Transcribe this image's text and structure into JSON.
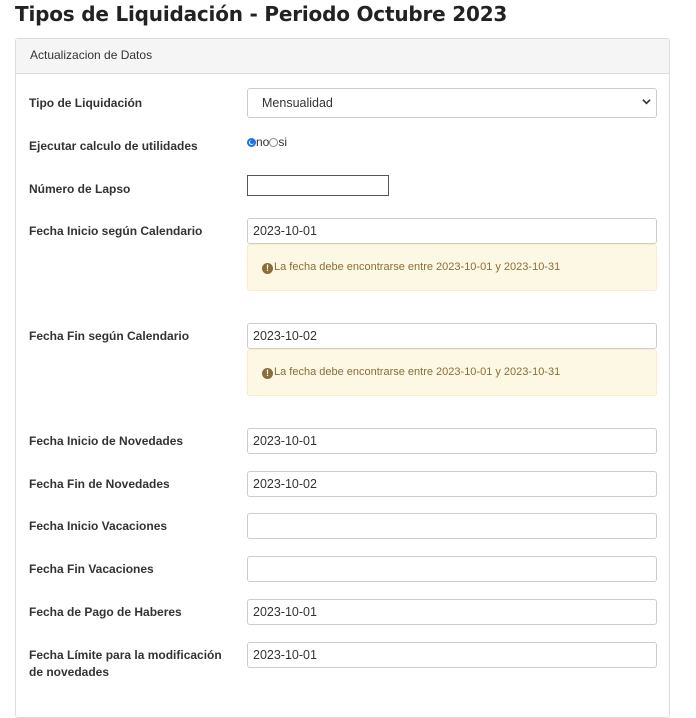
{
  "page": {
    "title": "Tipos de Liquidación - Periodo Octubre 2023"
  },
  "panel": {
    "heading": "Actualizacion de Datos"
  },
  "form": {
    "tipo_liquidacion": {
      "label": "Tipo de Liquidación",
      "value": "Mensualidad"
    },
    "ejecutar_utilidades": {
      "label": "Ejecutar calculo de utilidades",
      "options": [
        "no",
        "si"
      ],
      "selected": "no"
    },
    "numero_lapso": {
      "label": "Número de Lapso",
      "value": ""
    },
    "fecha_inicio_calendario": {
      "label": "Fecha Inicio según Calendario",
      "value": "2023-10-01",
      "warning": "La fecha debe encontrarse entre 2023-10-01 y 2023-10-31"
    },
    "fecha_fin_calendario": {
      "label": "Fecha Fin según Calendario",
      "value": "2023-10-02",
      "warning": "La fecha debe encontrarse entre 2023-10-01 y 2023-10-31"
    },
    "fecha_inicio_novedades": {
      "label": "Fecha Inicio de Novedades",
      "value": "2023-10-01"
    },
    "fecha_fin_novedades": {
      "label": "Fecha Fin de Novedades",
      "value": "2023-10-02"
    },
    "fecha_inicio_vacaciones": {
      "label": "Fecha Inicio Vacaciones",
      "value": ""
    },
    "fecha_fin_vacaciones": {
      "label": "Fecha Fin Vacaciones",
      "value": ""
    },
    "fecha_pago_haberes": {
      "label": "Fecha de Pago de Haberes",
      "value": "2023-10-01"
    },
    "fecha_limite_modificacion": {
      "label": "Fecha Límite para la modificación de novedades",
      "value": "2023-10-01"
    }
  },
  "colors": {
    "alert_bg": "#fcf8e3",
    "alert_text": "#8a6d3b",
    "radio_accent": "#1a73e8"
  },
  "icons": {
    "warning": "exclamation-circle-icon",
    "select": "chevron-down-icon"
  }
}
